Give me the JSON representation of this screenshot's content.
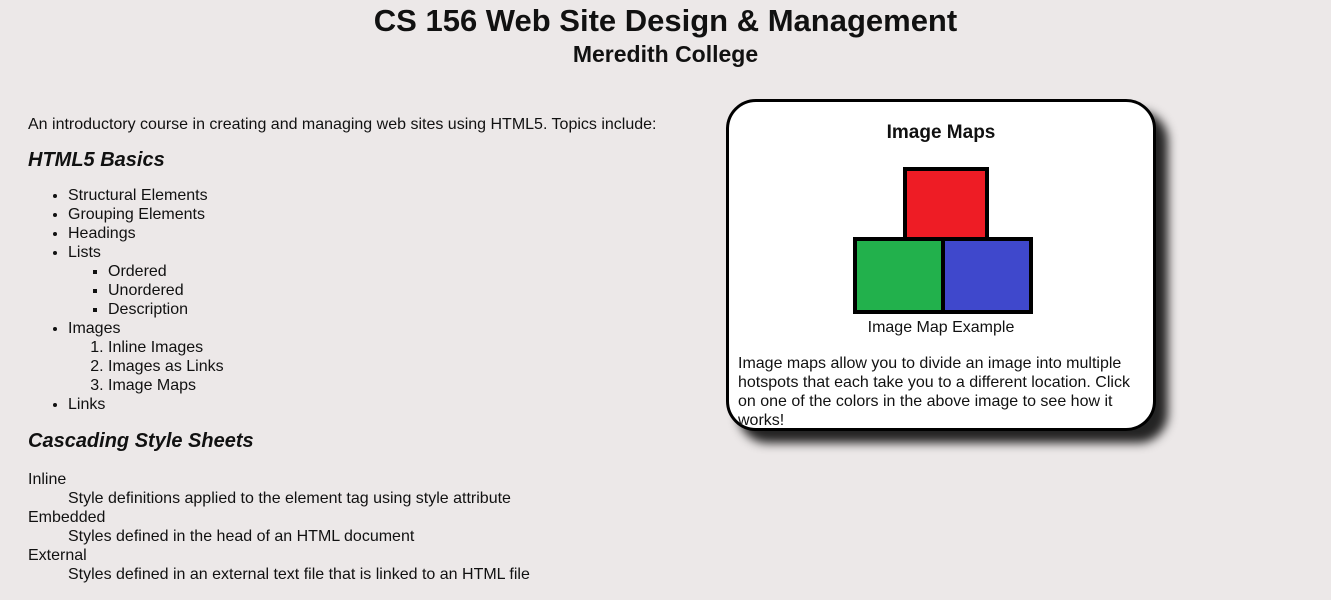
{
  "header": {
    "title": "CS 156 Web Site Design & Management",
    "subtitle": "Meredith College"
  },
  "main": {
    "intro": "An introductory course in creating and managing web sites using HTML5. Topics include:",
    "basics_heading": "HTML5 Basics",
    "topics": {
      "structural": "Structural Elements",
      "grouping": "Grouping Elements",
      "headings": "Headings",
      "lists": "Lists",
      "lists_sub": [
        "Ordered",
        "Unordered",
        "Description"
      ],
      "images": "Images",
      "images_sub": [
        "Inline Images",
        "Images as Links",
        "Image Maps"
      ],
      "links": "Links"
    },
    "css_heading": "Cascading Style Sheets",
    "styles": [
      {
        "term": "Inline",
        "desc": "Style definitions applied to the element tag using style attribute"
      },
      {
        "term": "Embedded",
        "desc": "Styles defined in the head of an HTML document"
      },
      {
        "term": "External",
        "desc": "Styles defined in an external text file that is linked to an HTML file"
      }
    ]
  },
  "card": {
    "title": "Image Maps",
    "caption": "Image Map Example",
    "text": "Image maps allow you to divide an image into multiple hotspots that each take you to a different location. Click on one of the colors in the above image to see how it works!",
    "colors": {
      "red": "#ee1c25",
      "green": "#22b14c",
      "blue": "#3f48cc"
    }
  }
}
